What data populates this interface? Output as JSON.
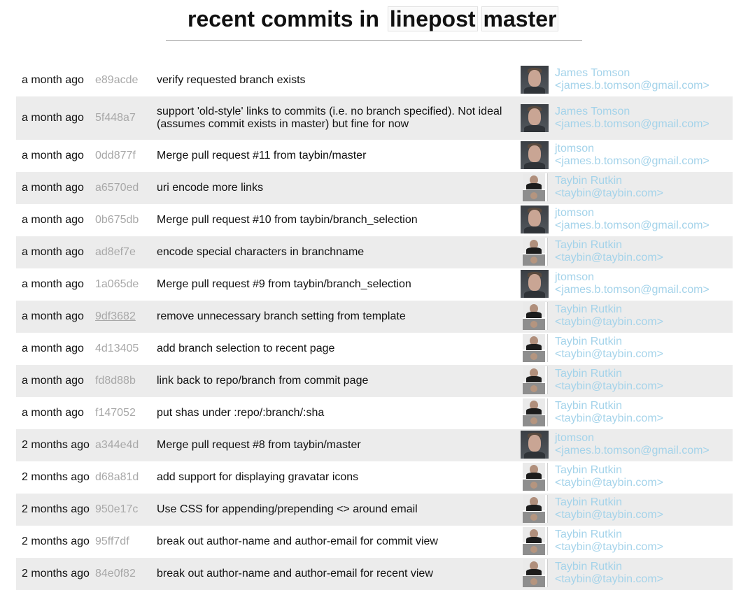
{
  "header": {
    "title_prefix": "recent commits in",
    "repo": "linepost",
    "branch": "master"
  },
  "colors": {
    "author_link": "#a4d3ea",
    "sha_text": "#a8a8a8",
    "row_alt_bg": "#ececec"
  },
  "commits": [
    {
      "when": "a month ago",
      "sha": "e89acde",
      "message": "verify requested branch exists",
      "author_name": "James Tomson",
      "author_email": "<james.b.tomson@gmail.com>",
      "avatar": "james-avatar-icon"
    },
    {
      "when": "a month ago",
      "sha": "5f448a7",
      "message": "support 'old-style' links to commits (i.e. no branch specified). Not ideal (assumes commit exists in master) but fine for now",
      "author_name": "James Tomson",
      "author_email": "<james.b.tomson@gmail.com>",
      "avatar": "james-avatar-icon"
    },
    {
      "when": "a month ago",
      "sha": "0dd877f",
      "message": "Merge pull request #11 from taybin/master",
      "author_name": "jtomson",
      "author_email": "<james.b.tomson@gmail.com>",
      "avatar": "james-avatar-icon"
    },
    {
      "when": "a month ago",
      "sha": "a6570ed",
      "message": "uri encode more links",
      "author_name": "Taybin Rutkin",
      "author_email": "<taybin@taybin.com>",
      "avatar": "taybin-avatar-icon"
    },
    {
      "when": "a month ago",
      "sha": "0b675db",
      "message": "Merge pull request #10 from taybin/branch_selection",
      "author_name": "jtomson",
      "author_email": "<james.b.tomson@gmail.com>",
      "avatar": "james-avatar-icon"
    },
    {
      "when": "a month ago",
      "sha": "ad8ef7e",
      "message": "encode special characters in branchname",
      "author_name": "Taybin Rutkin",
      "author_email": "<taybin@taybin.com>",
      "avatar": "taybin-avatar-icon"
    },
    {
      "when": "a month ago",
      "sha": "1a065de",
      "message": "Merge pull request #9 from taybin/branch_selection",
      "author_name": "jtomson",
      "author_email": "<james.b.tomson@gmail.com>",
      "avatar": "james-avatar-icon"
    },
    {
      "when": "a month ago",
      "sha": "9df3682",
      "message": "remove unnecessary branch setting from template",
      "author_name": "Taybin Rutkin",
      "author_email": "<taybin@taybin.com>",
      "avatar": "taybin-avatar-icon",
      "sha_underlined": true
    },
    {
      "when": "a month ago",
      "sha": "4d13405",
      "message": "add branch selection to recent page",
      "author_name": "Taybin Rutkin",
      "author_email": "<taybin@taybin.com>",
      "avatar": "taybin-avatar-icon"
    },
    {
      "when": "a month ago",
      "sha": "fd8d88b",
      "message": "link back to repo/branch from commit page",
      "author_name": "Taybin Rutkin",
      "author_email": "<taybin@taybin.com>",
      "avatar": "taybin-avatar-icon"
    },
    {
      "when": "a month ago",
      "sha": "f147052",
      "message": "put shas under :repo/:branch/:sha",
      "author_name": "Taybin Rutkin",
      "author_email": "<taybin@taybin.com>",
      "avatar": "taybin-avatar-icon"
    },
    {
      "when": "2 months ago",
      "sha": "a344e4d",
      "message": "Merge pull request #8 from taybin/master",
      "author_name": "jtomson",
      "author_email": "<james.b.tomson@gmail.com>",
      "avatar": "james-avatar-icon"
    },
    {
      "when": "2 months ago",
      "sha": "d68a81d",
      "message": "add support for displaying gravatar icons",
      "author_name": "Taybin Rutkin",
      "author_email": "<taybin@taybin.com>",
      "avatar": "taybin-avatar-icon"
    },
    {
      "when": "2 months ago",
      "sha": "950e17c",
      "message": "Use CSS for appending/prepending <> around email",
      "author_name": "Taybin Rutkin",
      "author_email": "<taybin@taybin.com>",
      "avatar": "taybin-avatar-icon"
    },
    {
      "when": "2 months ago",
      "sha": "95ff7df",
      "message": "break out author-name and author-email for commit view",
      "author_name": "Taybin Rutkin",
      "author_email": "<taybin@taybin.com>",
      "avatar": "taybin-avatar-icon"
    },
    {
      "when": "2 months ago",
      "sha": "84e0f82",
      "message": "break out author-name and author-email for recent view",
      "author_name": "Taybin Rutkin",
      "author_email": "<taybin@taybin.com>",
      "avatar": "taybin-avatar-icon"
    }
  ]
}
